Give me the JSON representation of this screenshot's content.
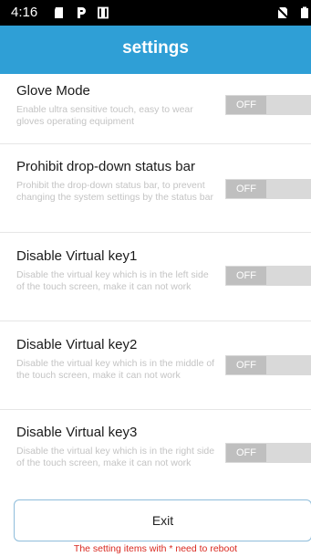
{
  "status_bar": {
    "time": "4:16",
    "icons_left": [
      "sd-card-icon",
      "p-icon",
      "tablet-icon"
    ],
    "icons_right": [
      "no-sim-icon",
      "battery-icon"
    ]
  },
  "app_bar": {
    "title": "settings",
    "color": "#2f9fd6"
  },
  "settings": [
    {
      "title": "Glove Mode",
      "description": "Enable ultra sensitive touch, easy to wear gloves operating equipment",
      "toggle_label": "OFF",
      "enabled": false
    },
    {
      "title": "Prohibit drop-down status bar",
      "description": "Prohibit the drop-down status bar, to prevent changing the system settings by the status bar",
      "toggle_label": "OFF",
      "enabled": false
    },
    {
      "title": "Disable Virtual key1",
      "description": "Disable the virtual key which is in the left side of the touch screen, make it can not work",
      "toggle_label": "OFF",
      "enabled": false
    },
    {
      "title": "Disable Virtual key2",
      "description": "Disable the virtual key which is in the middle of the touch screen, make it can not work",
      "toggle_label": "OFF",
      "enabled": false
    },
    {
      "title": "Disable Virtual key3",
      "description": "Disable the virtual key which is in the right side of the touch screen, make it can not work",
      "toggle_label": "OFF",
      "enabled": false
    }
  ],
  "exit_label": "Exit",
  "reboot_note": "The setting items with * need to reboot",
  "colors": {
    "note": "#d9281f",
    "description": "#c4c4c4"
  }
}
